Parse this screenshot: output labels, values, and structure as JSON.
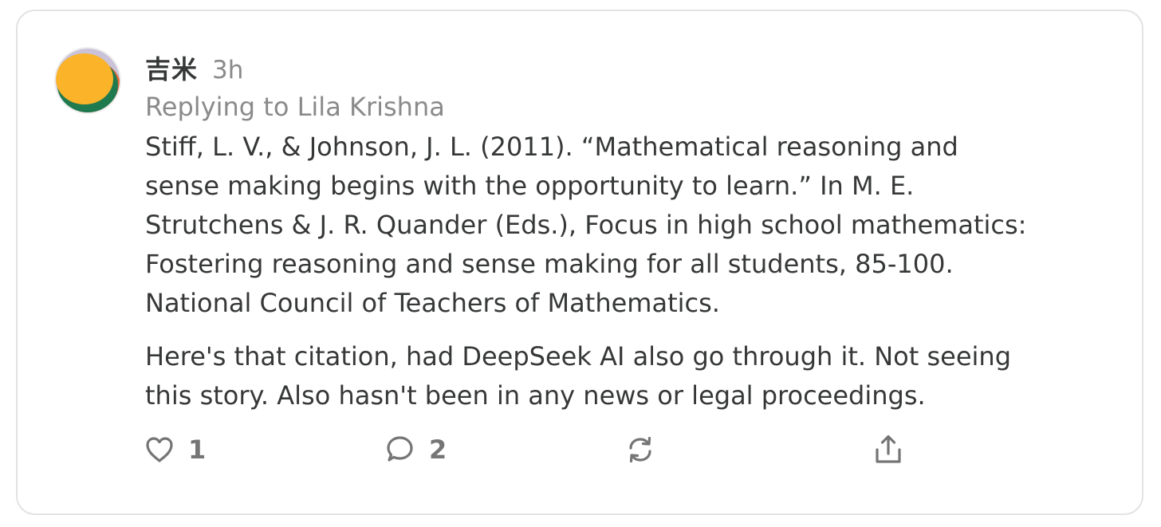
{
  "comment": {
    "author": "吉米",
    "time": "3h",
    "replying_to": "Replying to Lila Krishna",
    "paragraphs": [
      "Stiff, L. V., & Johnson, J. L. (2011). “Mathematical reasoning and\nsense making begins with the opportunity to learn.” In M. E.\nStrutchens & J. R. Quander (Eds.), Focus in high school mathematics:\nFostering reasoning and sense making for all students, 85-100.\nNational Council of Teachers of Mathematics.",
      "Here's that citation, had DeepSeek AI also go through it. Not seeing\nthis story. Also hasn't been in any news or legal proceedings."
    ]
  },
  "actions": {
    "like": {
      "icon": "heart-icon",
      "count": "1"
    },
    "reply": {
      "icon": "comment-icon",
      "count": "2"
    },
    "restack": {
      "icon": "restack-icon"
    },
    "share": {
      "icon": "share-icon"
    }
  },
  "colors": {
    "text": "#363737",
    "muted": "#8a8a8a",
    "icon": "#757575",
    "border": "#e3e3e3"
  }
}
